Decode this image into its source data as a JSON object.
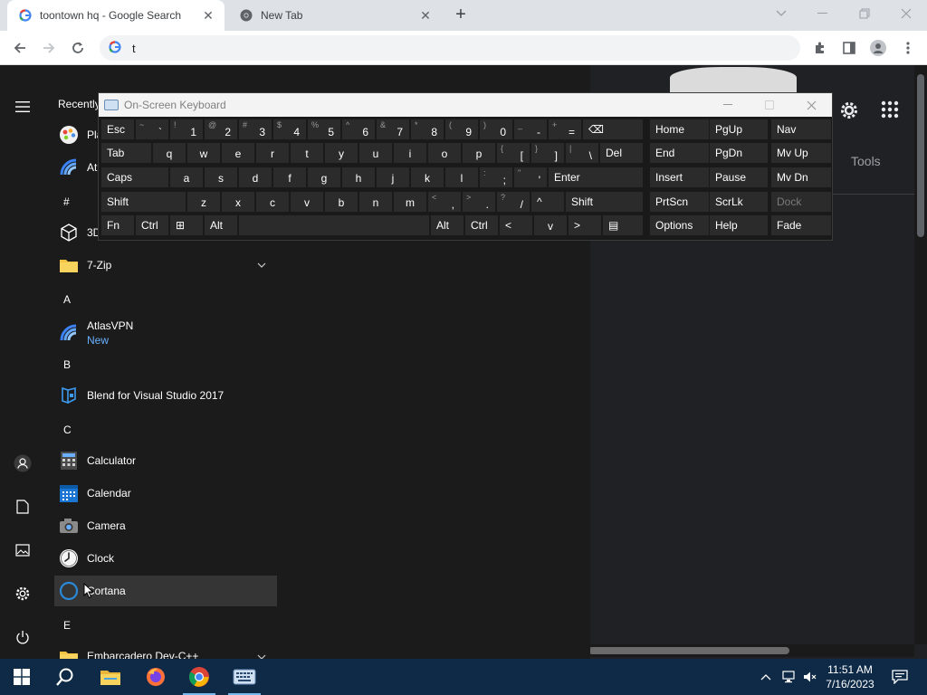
{
  "browser": {
    "tabs": [
      {
        "title": "toontown hq - Google Search",
        "favicon": "google-g-icon",
        "active": true
      },
      {
        "title": "New Tab",
        "favicon": "chrome-icon",
        "active": false
      }
    ],
    "address_value": "t",
    "window_controls": [
      "chevron-down-icon",
      "minimize-icon",
      "restore-icon",
      "close-icon"
    ]
  },
  "webpage": {
    "tools_label": "Tools"
  },
  "osk": {
    "title": "On-Screen Keyboard",
    "rows": [
      [
        {
          "main": "Esc"
        },
        {
          "sym": "~",
          "pri": "`"
        },
        {
          "sym": "!",
          "pri": "1"
        },
        {
          "sym": "@",
          "pri": "2"
        },
        {
          "sym": "#",
          "pri": "3"
        },
        {
          "sym": "$",
          "pri": "4"
        },
        {
          "sym": "%",
          "pri": "5"
        },
        {
          "sym": "^",
          "pri": "6"
        },
        {
          "sym": "&",
          "pri": "7"
        },
        {
          "sym": "*",
          "pri": "8"
        },
        {
          "sym": "(",
          "pri": "9"
        },
        {
          "sym": ")",
          "pri": "0"
        },
        {
          "sym": "_",
          "pri": "-"
        },
        {
          "sym": "+",
          "pri": "="
        },
        {
          "main": "⌫"
        },
        {
          "main": "Home"
        },
        {
          "main": "PgUp"
        },
        {
          "main": "Nav"
        }
      ],
      [
        {
          "main": "Tab"
        },
        {
          "main": "q"
        },
        {
          "main": "w"
        },
        {
          "main": "e"
        },
        {
          "main": "r"
        },
        {
          "main": "t"
        },
        {
          "main": "y"
        },
        {
          "main": "u"
        },
        {
          "main": "i"
        },
        {
          "main": "o"
        },
        {
          "main": "p"
        },
        {
          "sym": "{",
          "pri": "["
        },
        {
          "sym": "}",
          "pri": "]"
        },
        {
          "sym": "|",
          "pri": "\\"
        },
        {
          "main": "Del"
        },
        {
          "main": "End"
        },
        {
          "main": "PgDn"
        },
        {
          "main": "Mv Up"
        }
      ],
      [
        {
          "main": "Caps"
        },
        {
          "main": "a"
        },
        {
          "main": "s"
        },
        {
          "main": "d"
        },
        {
          "main": "f"
        },
        {
          "main": "g"
        },
        {
          "main": "h"
        },
        {
          "main": "j"
        },
        {
          "main": "k"
        },
        {
          "main": "l"
        },
        {
          "sym": ":",
          "pri": ";"
        },
        {
          "sym": "\"",
          "pri": "'"
        },
        {
          "main": "Enter"
        },
        {
          "main": "Insert"
        },
        {
          "main": "Pause"
        },
        {
          "main": "Mv Dn"
        }
      ],
      [
        {
          "main": "Shift"
        },
        {
          "main": "z"
        },
        {
          "main": "x"
        },
        {
          "main": "c"
        },
        {
          "main": "v"
        },
        {
          "main": "b"
        },
        {
          "main": "n"
        },
        {
          "main": "m"
        },
        {
          "sym": "<",
          "pri": ","
        },
        {
          "sym": ">",
          "pri": "."
        },
        {
          "sym": "?",
          "pri": "/"
        },
        {
          "main": "^"
        },
        {
          "main": "Shift"
        },
        {
          "main": "PrtScn"
        },
        {
          "main": "ScrLk"
        },
        {
          "main": "Dock"
        }
      ],
      [
        {
          "main": "Fn"
        },
        {
          "main": "Ctrl"
        },
        {
          "main": "⊞"
        },
        {
          "main": "Alt"
        },
        {
          "main": ""
        },
        {
          "main": "Alt"
        },
        {
          "main": "Ctrl"
        },
        {
          "main": "<"
        },
        {
          "main": "v"
        },
        {
          "main": ">"
        },
        {
          "main": "▤"
        },
        {
          "main": "Options"
        },
        {
          "main": "Help"
        },
        {
          "main": "Fade"
        }
      ]
    ]
  },
  "startmenu": {
    "recently_label": "Recently",
    "apps": [
      {
        "label": "Pla",
        "icon": "paint-icon"
      },
      {
        "label": "At",
        "icon": "atlasvpn-icon"
      },
      {
        "letter": "#"
      },
      {
        "label": "3D",
        "icon": "3d-cube-icon"
      },
      {
        "label": "7-Zip",
        "icon": "folder-icon",
        "chevron": true
      },
      {
        "letter": "A"
      },
      {
        "label": "AtlasVPN",
        "sub": "New",
        "icon": "atlasvpn-icon"
      },
      {
        "letter": "B"
      },
      {
        "label": "Blend for Visual Studio 2017",
        "icon": "blend-icon"
      },
      {
        "letter": "C"
      },
      {
        "label": "Calculator",
        "icon": "calculator-icon"
      },
      {
        "label": "Calendar",
        "icon": "calendar-icon"
      },
      {
        "label": "Camera",
        "icon": "camera-icon"
      },
      {
        "label": "Clock",
        "icon": "clock-icon"
      },
      {
        "label": "Cortana",
        "icon": "cortana-icon",
        "highlight": true
      },
      {
        "letter": "E"
      },
      {
        "label": "Embarcadero Dev-C++",
        "icon": "folder-icon",
        "chevron": true
      }
    ]
  },
  "taskbar": {
    "time": "11:51 AM",
    "date": "7/16/2023",
    "apps": [
      "windows-start-icon",
      "search-icon",
      "file-explorer-icon",
      "firefox-icon",
      "chrome-icon",
      "onscreen-keyboard-icon"
    ]
  },
  "colors": {
    "taskbar": "#0e2a47",
    "startmenu": "#1b1b1b",
    "accent_link": "#6ab0ff"
  }
}
